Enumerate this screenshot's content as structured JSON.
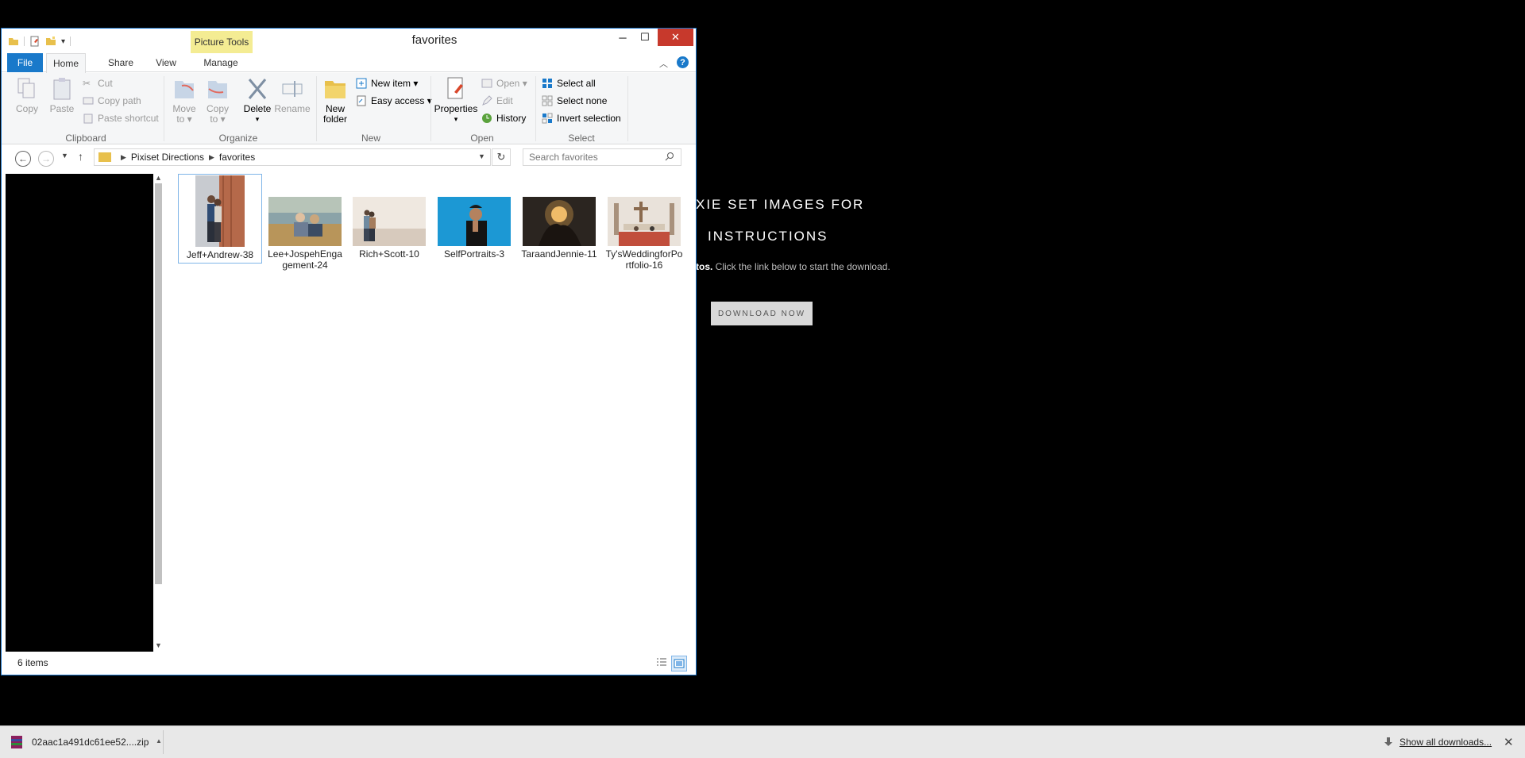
{
  "background_page": {
    "title_line1": "XIE SET IMAGES FOR",
    "title_line2": "INSTRUCTIONS",
    "text_bold": "tos.",
    "text": " Click the link below to start the download.",
    "download_button": "DOWNLOAD NOW"
  },
  "window": {
    "title": "favorites",
    "contextual_tab_group": "Picture Tools",
    "close_glyph": "✕",
    "min_glyph": "─",
    "max_glyph": "☐"
  },
  "ribbon_tabs": {
    "file": "File",
    "home": "Home",
    "share": "Share",
    "view": "View",
    "manage": "Manage"
  },
  "ribbon": {
    "clipboard": {
      "label": "Clipboard",
      "copy": "Copy",
      "paste": "Paste",
      "cut": "Cut",
      "copy_path": "Copy path",
      "paste_shortcut": "Paste shortcut"
    },
    "organize": {
      "label": "Organize",
      "move_to_1": "Move",
      "move_to_2": "to ▾",
      "copy_to_1": "Copy",
      "copy_to_2": "to ▾",
      "delete": "Delete",
      "delete_caret": "▾",
      "rename": "Rename"
    },
    "new": {
      "label": "New",
      "new_folder_1": "New",
      "new_folder_2": "folder",
      "new_item": "New item ▾",
      "easy_access": "Easy access ▾"
    },
    "open": {
      "label": "Open",
      "properties": "Properties",
      "properties_caret": "▾",
      "open": "Open ▾",
      "edit": "Edit",
      "history": "History"
    },
    "select": {
      "label": "Select",
      "select_all": "Select all",
      "select_none": "Select none",
      "invert_selection": "Invert selection"
    }
  },
  "address": {
    "crumbs": [
      "Pixiset Directions",
      "favorites"
    ],
    "search_placeholder": "Search favorites"
  },
  "files": [
    {
      "name": "Jeff+Andrew-38",
      "selected": true
    },
    {
      "name": "Lee+JospehEngagement-24",
      "selected": false
    },
    {
      "name": "Rich+Scott-10",
      "selected": false
    },
    {
      "name": "SelfPortraits-3",
      "selected": false
    },
    {
      "name": "TaraandJennie-11",
      "selected": false
    },
    {
      "name": "Ty'sWeddingforPortfolio-16",
      "selected": false
    }
  ],
  "status": {
    "item_count": "6 items"
  },
  "download_bar": {
    "filename": "02aac1a491dc61ee52....zip",
    "show_all": "Show all downloads...",
    "close_glyph": "✕"
  },
  "colors": {
    "accent": "#1979ca",
    "close_red": "#c7392c",
    "picture_tools": "#f4ec93"
  }
}
